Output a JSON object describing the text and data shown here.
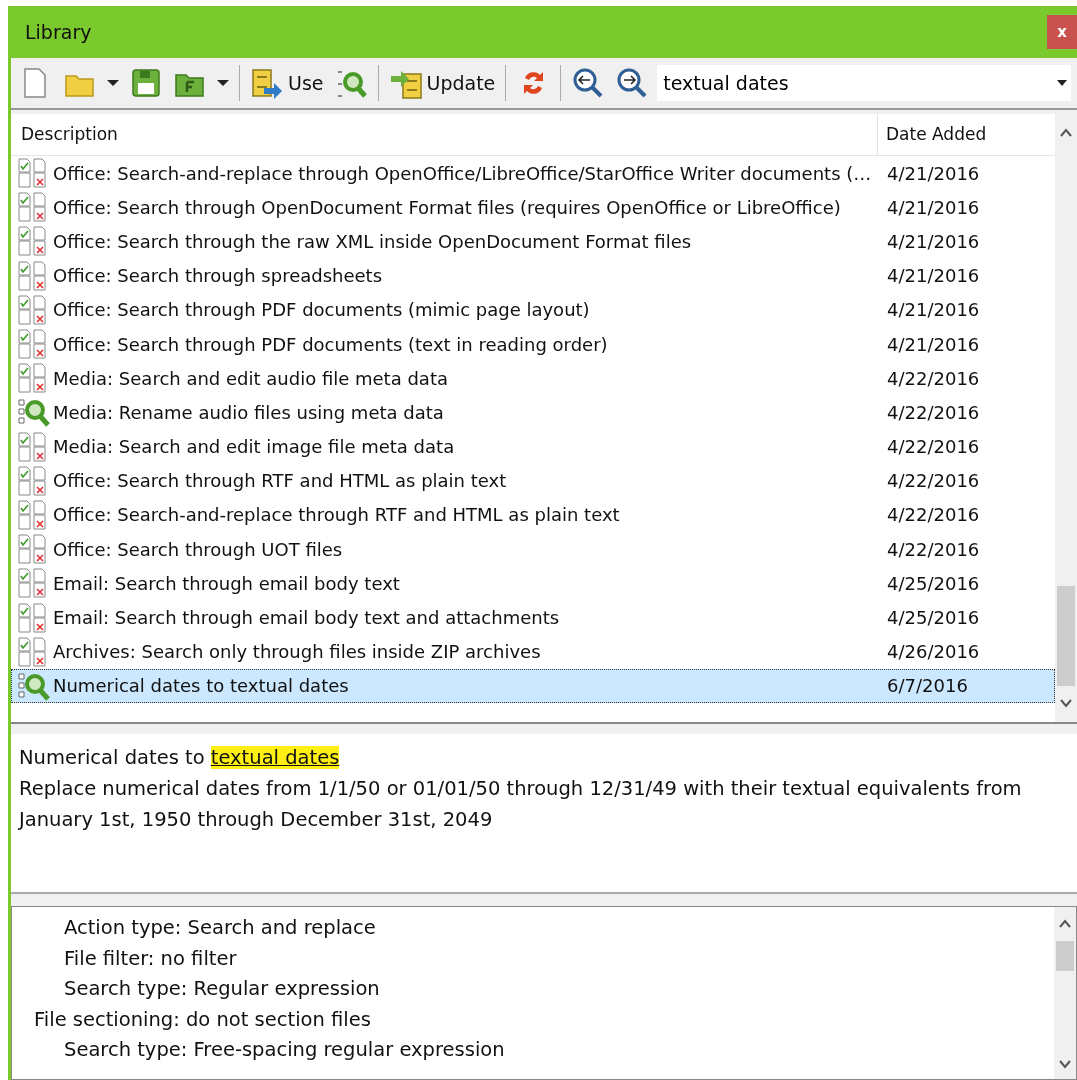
{
  "window": {
    "title": "Library",
    "close": "x"
  },
  "toolbar": {
    "use_label": "Use",
    "update_label": "Update",
    "search": {
      "value": "textual dates"
    }
  },
  "table": {
    "columns": [
      "Description",
      "Date Added"
    ],
    "rows": [
      {
        "kind": "replace",
        "description": "Office: Search-and-replace through OpenOffice/LibreOffice/StarOffice Writer documents (…",
        "date": "4/21/2016",
        "selected": false
      },
      {
        "kind": "replace",
        "description": "Office: Search through OpenDocument Format files (requires OpenOffice or LibreOffice)",
        "date": "4/21/2016",
        "selected": false
      },
      {
        "kind": "replace",
        "description": "Office: Search through the raw XML inside OpenDocument Format files",
        "date": "4/21/2016",
        "selected": false
      },
      {
        "kind": "replace",
        "description": "Office: Search through spreadsheets",
        "date": "4/21/2016",
        "selected": false
      },
      {
        "kind": "replace",
        "description": "Office: Search through PDF documents (mimic page layout)",
        "date": "4/21/2016",
        "selected": false
      },
      {
        "kind": "replace",
        "description": "Office: Search through PDF documents (text in reading order)",
        "date": "4/21/2016",
        "selected": false
      },
      {
        "kind": "replace",
        "description": "Media: Search and edit audio file meta data",
        "date": "4/22/2016",
        "selected": false
      },
      {
        "kind": "search",
        "description": "Media: Rename audio files using meta data",
        "date": "4/22/2016",
        "selected": false
      },
      {
        "kind": "replace",
        "description": "Media: Search and edit image file meta data",
        "date": "4/22/2016",
        "selected": false
      },
      {
        "kind": "replace",
        "description": "Office: Search through RTF and HTML as plain text",
        "date": "4/22/2016",
        "selected": false
      },
      {
        "kind": "replace",
        "description": "Office: Search-and-replace through RTF and HTML as plain text",
        "date": "4/22/2016",
        "selected": false
      },
      {
        "kind": "replace",
        "description": "Office: Search through UOT files",
        "date": "4/22/2016",
        "selected": false
      },
      {
        "kind": "replace",
        "description": "Email: Search through email body text",
        "date": "4/25/2016",
        "selected": false
      },
      {
        "kind": "replace",
        "description": "Email: Search through email body text and attachments",
        "date": "4/25/2016",
        "selected": false
      },
      {
        "kind": "replace",
        "description": "Archives: Search only through files inside ZIP archives",
        "date": "4/26/2016",
        "selected": false
      },
      {
        "kind": "search",
        "description": "Numerical dates to textual dates",
        "date": "6/7/2016",
        "selected": true
      }
    ]
  },
  "description": {
    "title": "Numerical dates to",
    "highlight": "textual dates",
    "text": "Replace numerical dates from 1/1/50 or 01/01/50 through 12/31/49 with their textual equivalents from January 1st, 1950 through December 31st, 2049"
  },
  "details": [
    {
      "children": [
        {
          "text": "Action type: Search and replace"
        },
        {
          "text": "File filter: no filter"
        },
        {
          "text": "Search type: Regular expression"
        }
      ]
    },
    {
      "text": "File sectioning: do not section files",
      "children": [
        {
          "text": "Search type: Free-spacing regular expression"
        }
      ]
    }
  ]
}
